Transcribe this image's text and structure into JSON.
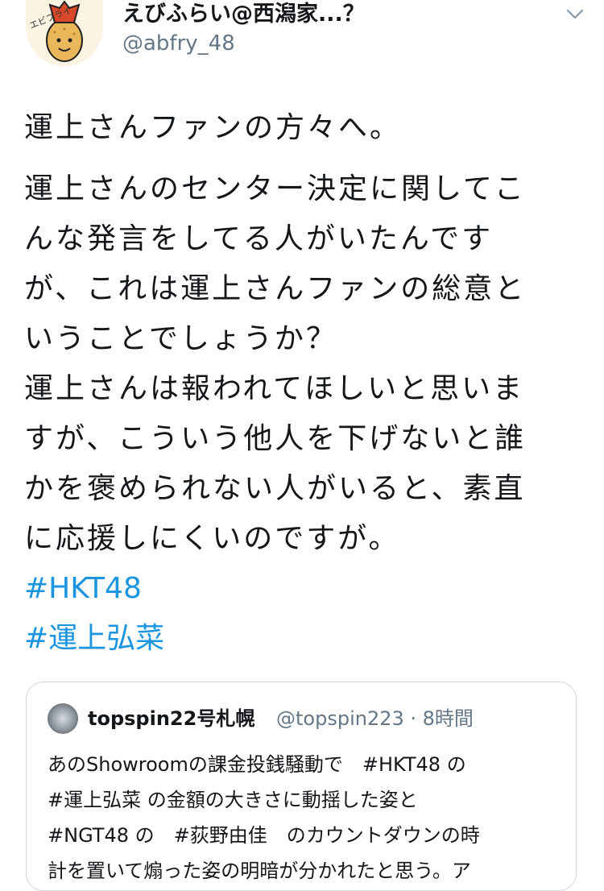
{
  "author": {
    "display_name": "えびふらい@西潟家...？",
    "handle": "@abfry_48",
    "avatar_text": "エビフライ",
    "avatar_icon": "fried-shrimp-icon"
  },
  "menu_icon": "chevron-down-icon",
  "tweet": {
    "paragraph_1": "運上さんファンの方々へ。",
    "lines": [
      "運上さんのセンター決定に関してこ",
      "んな発言をしてる人がいたんです",
      "が、これは運上さんファンの総意と",
      "いうことでしょうか？",
      "運上さんは報われてほしいと思いま",
      "すが、こういう他人を下げないと誰",
      "かを褒められない人がいると、素直",
      "に応援しにくいのですが。"
    ],
    "hashtags": [
      "#HKT48",
      "#運上弘菜"
    ]
  },
  "quoted": {
    "display_name": "topspin22号札幌",
    "handle_time": "@topspin223 · 8時間",
    "lines": [
      "あのShowroomの課金投銭騒動で　#HKT48 の",
      "#運上弘菜 の金額の大きさに動揺した姿と",
      "#NGT48 の　#荻野由佳　のカウントダウンの時",
      "計を置いて煽った姿の明暗が分かれたと思う。ア"
    ]
  },
  "colors": {
    "hashtag": "#1b95e0",
    "secondary_text": "#657786",
    "border": "#ccd6dd"
  }
}
